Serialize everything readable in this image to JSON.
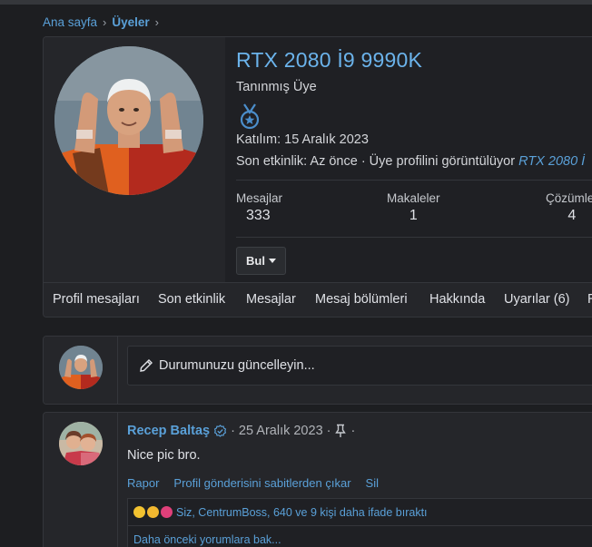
{
  "breadcrumb": {
    "home": "Ana sayfa",
    "section": "Üyeler",
    "sep": "›"
  },
  "profile": {
    "username": "RTX 2080 İ9 9990K",
    "title": "Tanınmış Üye",
    "award_icon": "medal-icon",
    "joined": "Katılım: 15 Aralık 2023",
    "last_activity_prefix": "Son etkinlik: Az önce · Üye profilini görüntülüyor",
    "last_activity_link": "RTX 2080 İ",
    "stats": [
      {
        "label": "Mesajlar",
        "value": "333"
      },
      {
        "label": "Makaleler",
        "value": "1"
      },
      {
        "label": "Çözümler",
        "value": "4"
      }
    ],
    "find_button": "Bul"
  },
  "tabs": [
    {
      "label": "Profil mesajları",
      "active": true
    },
    {
      "label": "Son etkinlik"
    },
    {
      "label": "Mesajlar"
    },
    {
      "label": "Mesaj bölümleri"
    },
    {
      "label": "Hakkında"
    },
    {
      "label": "Uyarılar (6)"
    },
    {
      "label": "R"
    }
  ],
  "status": {
    "placeholder": "Durumunuzu güncelleyin...",
    "icon": "pencil-icon"
  },
  "post": {
    "author": "Recep Baltaş",
    "date": "25 Aralık 2023",
    "dot": "·",
    "body": "Nice pic bro.",
    "actions": [
      "Rapor",
      "Profil gönderisini sabitlerden çıkar",
      "Sil"
    ],
    "reactions_text": "Siz, CentrumBoss, 640 ve 9 kişi daha ifade bıraktı",
    "earlier_link": "Daha önceki yorumlara bak..."
  },
  "colors": {
    "accent": "#5aa0d8",
    "username": "#6bb3eb",
    "background": "#1d1e21",
    "card": "#25262a",
    "tab_underline": "#4b8ecb"
  }
}
